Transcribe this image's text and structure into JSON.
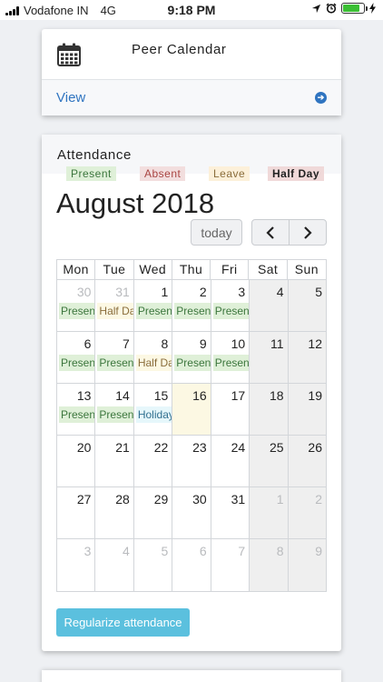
{
  "status_bar": {
    "carrier": "Vodafone IN",
    "network": "4G",
    "time": "9:18 PM",
    "battery_level": 0.8,
    "battery_color": "#3bbf34"
  },
  "peer_card": {
    "icon": "calendar-icon",
    "title": "Peer Calendar",
    "link_label": "View",
    "link_icon": "arrow-right-circle-icon",
    "link_color": "#2f74c0"
  },
  "attendance": {
    "title": "Attendance",
    "legend": {
      "present": "Present",
      "absent": "Absent",
      "leave": "Leave",
      "half_day": "Half Day"
    },
    "month_title": "August 2018",
    "today_label": "today",
    "prev_icon": "chevron-left-icon",
    "next_icon": "chevron-right-icon",
    "weekdays": [
      "Mon",
      "Tue",
      "Wed",
      "Thu",
      "Fri",
      "Sat",
      "Sun"
    ],
    "weeks": [
      [
        {
          "day": "30",
          "other": true,
          "event": "Present",
          "type": "present"
        },
        {
          "day": "31",
          "other": true,
          "event": "Half Day",
          "type": "halfday"
        },
        {
          "day": "1",
          "event": "Present",
          "type": "present"
        },
        {
          "day": "2",
          "event": "Present",
          "type": "present"
        },
        {
          "day": "3",
          "event": "Present",
          "type": "present"
        },
        {
          "day": "4",
          "weekend": true
        },
        {
          "day": "5",
          "weekend": true
        }
      ],
      [
        {
          "day": "6",
          "event": "Present",
          "type": "present"
        },
        {
          "day": "7",
          "event": "Present",
          "type": "present"
        },
        {
          "day": "8",
          "event": "Half Day",
          "type": "halfday"
        },
        {
          "day": "9",
          "event": "Present",
          "type": "present"
        },
        {
          "day": "10",
          "event": "Present",
          "type": "present"
        },
        {
          "day": "11",
          "weekend": true
        },
        {
          "day": "12",
          "weekend": true
        }
      ],
      [
        {
          "day": "13",
          "event": "Present",
          "type": "present"
        },
        {
          "day": "14",
          "event": "Present",
          "type": "present"
        },
        {
          "day": "15",
          "event": "Holiday",
          "type": "holiday"
        },
        {
          "day": "16",
          "today": true
        },
        {
          "day": "17"
        },
        {
          "day": "18",
          "weekend": true
        },
        {
          "day": "19",
          "weekend": true
        }
      ],
      [
        {
          "day": "20"
        },
        {
          "day": "21"
        },
        {
          "day": "22"
        },
        {
          "day": "23"
        },
        {
          "day": "24"
        },
        {
          "day": "25",
          "weekend": true
        },
        {
          "day": "26",
          "weekend": true
        }
      ],
      [
        {
          "day": "27"
        },
        {
          "day": "28"
        },
        {
          "day": "29"
        },
        {
          "day": "30"
        },
        {
          "day": "31"
        },
        {
          "day": "1",
          "other": true,
          "weekend": true
        },
        {
          "day": "2",
          "other": true,
          "weekend": true
        }
      ],
      [
        {
          "day": "3",
          "other": true
        },
        {
          "day": "4",
          "other": true
        },
        {
          "day": "5",
          "other": true
        },
        {
          "day": "6",
          "other": true
        },
        {
          "day": "7",
          "other": true
        },
        {
          "day": "8",
          "other": true,
          "weekend": true
        },
        {
          "day": "9",
          "other": true,
          "weekend": true
        }
      ]
    ],
    "regularize_label": "Regularize attendance",
    "regularize_color": "#5bc0de"
  }
}
